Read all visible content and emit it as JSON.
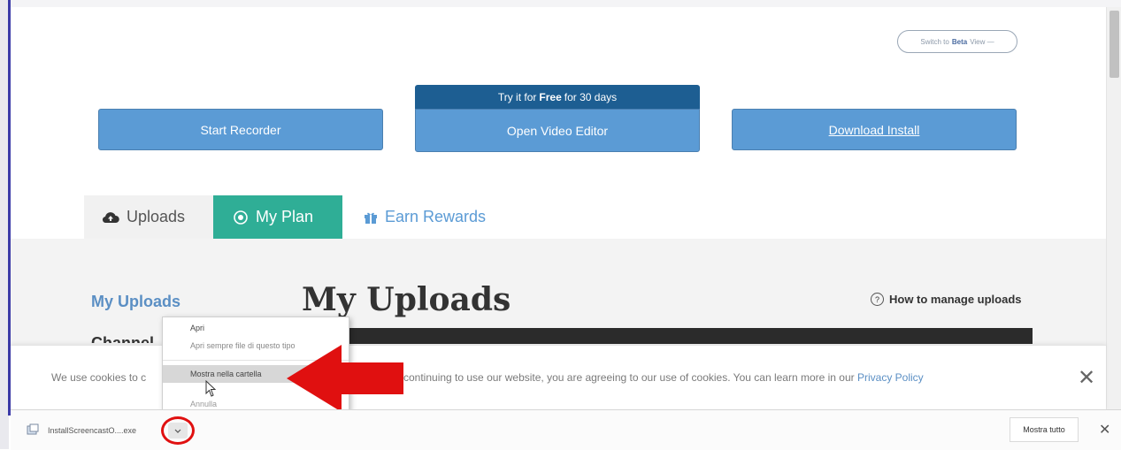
{
  "header": {
    "beta_toggle_prefix": "Switch to",
    "beta_toggle_bold": "Beta",
    "beta_toggle_suffix": "View —"
  },
  "actions": {
    "start_recorder": "Start Recorder",
    "trial_prefix": "Try it for",
    "trial_bold": "Free",
    "trial_suffix": "for 30 days",
    "open_video_editor": "Open Video Editor",
    "download_install": "Download Install"
  },
  "tabs": [
    {
      "label": "Uploads",
      "icon": "cloud-upload-icon"
    },
    {
      "label": "My Plan",
      "icon": "target-icon"
    },
    {
      "label": "Earn Rewards",
      "icon": "gift-icon"
    }
  ],
  "sidebar": {
    "my_uploads": "My Uploads",
    "second_item": "Channel"
  },
  "main": {
    "title": "My Uploads",
    "help_link": "How to manage uploads"
  },
  "cookie_banner": {
    "text_start": "We use cookies to c",
    "text_end": "continuing to use our website, you are agreeing to our use of cookies. You can learn more in our",
    "privacy_link": "Privacy Policy",
    "close_glyph": "✕"
  },
  "context_menu": {
    "items": [
      "Apri",
      "Apri sempre file di questo tipo",
      "Mostra nella cartella",
      "Annulla"
    ]
  },
  "download_shelf": {
    "file_name": "InstallScreencastO....exe",
    "show_all": "Mostra tutto",
    "close_glyph": "✕"
  },
  "colors": {
    "primary_blue": "#5b9bd5",
    "banner_blue": "#1d5e92",
    "teal": "#2fae96",
    "highlight_red": "#e01010"
  }
}
